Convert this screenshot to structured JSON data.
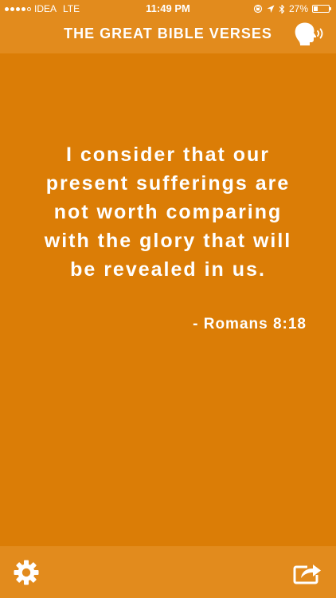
{
  "status_bar": {
    "signal_bars_filled": 4,
    "signal_bars_total": 5,
    "carrier": "IDEA",
    "network": "LTE",
    "time": "11:49 PM",
    "battery_percent": "27%",
    "battery_level": 0.27,
    "icons": [
      "rotation-lock-icon",
      "location-arrow-icon",
      "bluetooth-icon",
      "battery-icon"
    ]
  },
  "header": {
    "title": "THE GREAT BIBLE VERSES",
    "speak_icon": "speaking-head-icon"
  },
  "verse": {
    "lines": [
      "I consider that our",
      "present sufferings are",
      "not worth comparing",
      "with the glory that will",
      "be revealed in us."
    ],
    "reference": "- Romans 8:18"
  },
  "footer": {
    "settings_icon": "gear-icon",
    "share_icon": "share-icon"
  },
  "colors": {
    "background": "#DB7D06",
    "bar": "#E28B1D",
    "text": "#FFFFFF"
  }
}
